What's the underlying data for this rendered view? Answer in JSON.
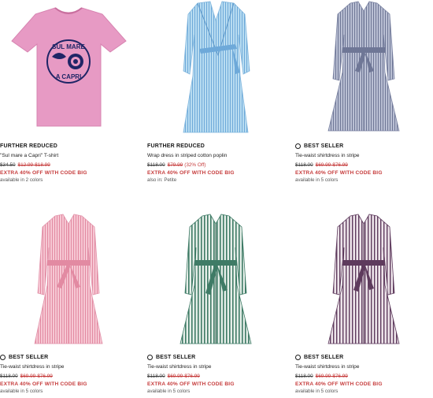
{
  "products": [
    {
      "badge": "FURTHER REDUCED",
      "name": "\"Sul mare a Capri\" T-shirt",
      "price_original": "$34.50",
      "price_sale": "$12.99-$18.99",
      "price_pct": "",
      "promo": "EXTRA 40% OFF WITH CODE BIG",
      "colors": "available in 2 colors",
      "tshirt_text_top": "SUL MARE",
      "tshirt_text_bottom": "A CAPRI",
      "colors_hex": {
        "primary": "#e79ac4",
        "print": "#1f2566"
      }
    },
    {
      "badge": "FURTHER REDUCED",
      "name": "Wrap dress in striped cotton poplin",
      "price_original": "$118.00",
      "price_sale": "$79.99",
      "price_pct": "(32% Off)",
      "promo": "EXTRA 40% OFF WITH CODE BIG",
      "colors": "also in: Petite",
      "colors_hex": {
        "primary": "#a9d3ee",
        "stripe": "#6ea9d9"
      }
    },
    {
      "badge": "BEST SELLER",
      "name": "Tie-waist shirtdress in stripe",
      "price_original": "$118.00",
      "price_sale": "$69.99-$76.99",
      "price_pct": "",
      "promo": "EXTRA 40% OFF WITH CODE BIG",
      "colors": "available in 5 colors",
      "colors_hex": {
        "primary": "#a6adc4",
        "stripe": "#6f7796"
      }
    },
    {
      "badge": "BEST SELLER",
      "name": "Tie-waist shirtdress in stripe",
      "price_original": "$118.00",
      "price_sale": "$69.99-$76.99",
      "price_pct": "",
      "promo": "EXTRA 40% OFF WITH CODE BIG",
      "colors": "available in 5 colors",
      "colors_hex": {
        "primary": "#f2b9c8",
        "stripe": "#e28aa2"
      }
    },
    {
      "badge": "BEST SELLER",
      "name": "Tie-waist shirtdress in stripe",
      "price_original": "$118.00",
      "price_sale": "$69.99-$76.99",
      "price_pct": "",
      "promo": "EXTRA 40% OFF WITH CODE BIG",
      "colors": "available in 5 colors",
      "colors_hex": {
        "primary": "#d9e6e0",
        "stripe": "#3f7b66"
      }
    },
    {
      "badge": "BEST SELLER",
      "name": "Tie-waist shirtdress in stripe",
      "price_original": "$118.00",
      "price_sale": "$69.99-$76.99",
      "price_pct": "",
      "promo": "EXTRA 40% OFF WITH CODE BIG",
      "colors": "available in 5 colors",
      "colors_hex": {
        "primary": "#e9dfe6",
        "stripe": "#5e3b5d"
      }
    }
  ]
}
